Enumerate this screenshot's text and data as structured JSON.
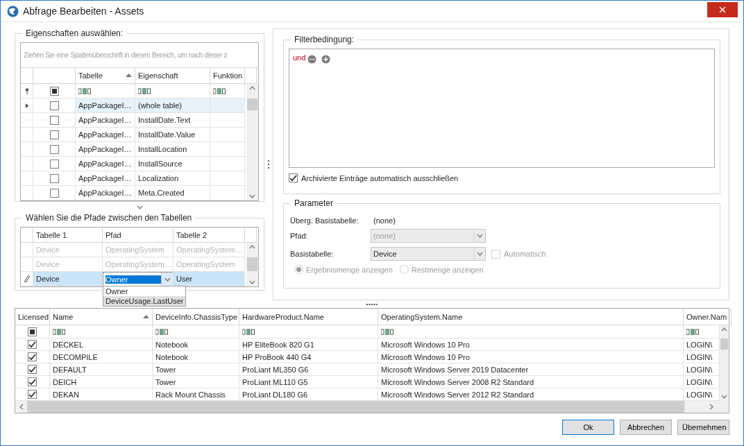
{
  "window": {
    "title": "Abfrage Bearbeiten - Assets"
  },
  "properties": {
    "title": "Eigenschaften auswählen:",
    "group_hint": "Ziehen Sie eine Spaltenüberschrift in diesen Bereich, um nach dieser z",
    "select_all_indeterminate": true,
    "columns": [
      {
        "label": "Tabelle",
        "sorted": true
      },
      {
        "label": "Eigenschaft",
        "sorted": false
      },
      {
        "label": "Funktion",
        "sorted": false
      }
    ],
    "rows": [
      {
        "table": "AppPackageI…",
        "property": "(whole table)",
        "checked": false,
        "selected": true
      },
      {
        "table": "AppPackageI…",
        "property": "InstallDate.Text",
        "checked": false,
        "selected": false
      },
      {
        "table": "AppPackageI…",
        "property": "InstallDate.Value",
        "checked": false,
        "selected": false
      },
      {
        "table": "AppPackageI…",
        "property": "InstallLocation",
        "checked": false,
        "selected": false
      },
      {
        "table": "AppPackageI…",
        "property": "InstallSource",
        "checked": false,
        "selected": false
      },
      {
        "table": "AppPackageI…",
        "property": "Localization",
        "checked": false,
        "selected": false
      },
      {
        "table": "AppPackageI…",
        "property": "Meta.Created",
        "checked": false,
        "selected": false
      }
    ]
  },
  "paths": {
    "title": "Wählen Sie die Pfade zwischen den Tabellen",
    "columns": [
      "Tabelle 1",
      "Pfad",
      "Tabelle 2"
    ],
    "rows": [
      {
        "table_1": "Device",
        "path": "OperatingSystem",
        "table_2": "OperatingSystem…",
        "disabled": true,
        "editing": false
      },
      {
        "table_1": "Device",
        "path": "OperatingSystem…",
        "table_2": "OperatingSystem",
        "disabled": true,
        "editing": false
      },
      {
        "table_1": "Device",
        "path": "Owner",
        "table_2": "User",
        "disabled": false,
        "editing": true
      }
    ],
    "dropdown": [
      {
        "label": "Owner",
        "selected": false
      },
      {
        "label": "DeviceUsage.LastUser",
        "selected": true
      }
    ]
  },
  "filter": {
    "title": "Filterbedingung:",
    "operator": "und",
    "exclude_archived": {
      "label": "Archivierte Einträge automatisch ausschließen",
      "checked": true
    }
  },
  "parameters": {
    "title": "Parameter",
    "inherited_label": "Überg. Basistabelle:",
    "inherited_value": "(none)",
    "path": {
      "label": "Pfad:",
      "value": "(none)",
      "disabled": true
    },
    "base_table": {
      "label": "Basistabelle:",
      "value": "Device",
      "disabled": false
    },
    "automatic": {
      "label": "Automatisch",
      "checked": false,
      "disabled": true
    },
    "display_modes": [
      {
        "label": "Ergebnismenge anzeigen",
        "selected": true,
        "disabled": true
      },
      {
        "label": "Restmenge anzeigen",
        "selected": false,
        "disabled": true
      }
    ]
  },
  "results": {
    "select_all_indeterminate": true,
    "licensed_column": "Licensed",
    "columns": [
      {
        "label": "Name",
        "sorted": true
      },
      {
        "label": "DeviceInfo.ChassisType",
        "sorted": false
      },
      {
        "label": "HardwareProduct.Name",
        "sorted": false
      },
      {
        "label": "OperatingSystem.Name",
        "sorted": false
      },
      {
        "label": "Owner.Nam",
        "sorted": false
      }
    ],
    "rows": [
      {
        "licensed": true,
        "cells": [
          "DECKEL",
          "Notebook",
          "HP EliteBook 820 G1",
          "Microsoft Windows 10 Pro",
          "LOGIN\\"
        ]
      },
      {
        "licensed": true,
        "cells": [
          "DECOMPILE",
          "Notebook",
          "HP ProBook 440 G4",
          "Microsoft Windows 10 Pro",
          "LOGIN\\"
        ]
      },
      {
        "licensed": true,
        "cells": [
          "DEFAULT",
          "Tower",
          "ProLiant ML350 G6",
          "Microsoft Windows Server 2019 Datacenter",
          "LOGIN\\"
        ]
      },
      {
        "licensed": true,
        "cells": [
          "DEICH",
          "Tower",
          "ProLiant ML110 G5",
          "Microsoft Windows Server 2008 R2 Standard",
          "LOGIN\\"
        ]
      },
      {
        "licensed": true,
        "cells": [
          "DEKAN",
          "Rack Mount Chassis",
          "ProLiant DL180 G6",
          "Microsoft Windows Server 2012 R2 Standard",
          "LOGIN\\"
        ]
      }
    ]
  },
  "buttons": [
    {
      "label": "Ok",
      "default": true
    },
    {
      "label": "Abbrechen",
      "default": false
    },
    {
      "label": "Übernehmen",
      "default": false
    }
  ]
}
